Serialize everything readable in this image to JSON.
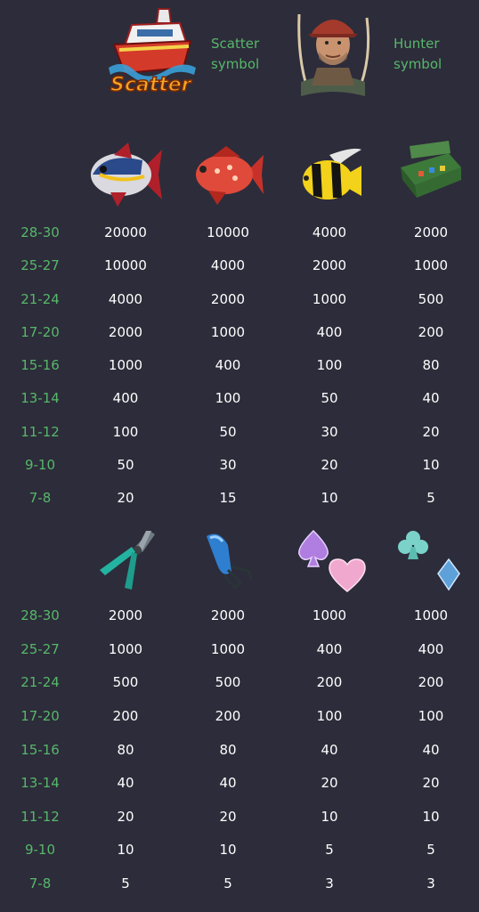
{
  "special_symbols": [
    {
      "name": "Scatter symbol",
      "label_line1": "Scatter",
      "label_line2": "symbol",
      "logo_text": "Scatter",
      "icon": "boat-scatter-icon"
    },
    {
      "name": "Hunter symbol",
      "label_line1": "Hunter",
      "label_line2": "symbol",
      "icon": "fisherman-hunter-icon"
    }
  ],
  "tables": [
    {
      "symbols": [
        "tuna-fish-icon",
        "red-fish-icon",
        "angelfish-icon",
        "tackle-box-icon"
      ],
      "rows": [
        {
          "range": "28-30",
          "values": [
            "20000",
            "10000",
            "4000",
            "2000"
          ]
        },
        {
          "range": "25-27",
          "values": [
            "10000",
            "4000",
            "2000",
            "1000"
          ]
        },
        {
          "range": "21-24",
          "values": [
            "4000",
            "2000",
            "1000",
            "500"
          ]
        },
        {
          "range": "17-20",
          "values": [
            "2000",
            "1000",
            "400",
            "200"
          ]
        },
        {
          "range": "15-16",
          "values": [
            "1000",
            "400",
            "100",
            "80"
          ]
        },
        {
          "range": "13-14",
          "values": [
            "400",
            "100",
            "50",
            "40"
          ]
        },
        {
          "range": "11-12",
          "values": [
            "100",
            "50",
            "30",
            "20"
          ]
        },
        {
          "range": "9-10",
          "values": [
            "50",
            "30",
            "20",
            "10"
          ]
        },
        {
          "range": "7-8",
          "values": [
            "20",
            "15",
            "10",
            "5"
          ]
        }
      ]
    },
    {
      "symbols": [
        "pliers-icon",
        "fishing-lure-icon",
        "spade-heart-icon",
        "club-diamond-icon"
      ],
      "rows": [
        {
          "range": "28-30",
          "values": [
            "2000",
            "2000",
            "1000",
            "1000"
          ]
        },
        {
          "range": "25-27",
          "values": [
            "1000",
            "1000",
            "400",
            "400"
          ]
        },
        {
          "range": "21-24",
          "values": [
            "500",
            "500",
            "200",
            "200"
          ]
        },
        {
          "range": "17-20",
          "values": [
            "200",
            "200",
            "100",
            "100"
          ]
        },
        {
          "range": "15-16",
          "values": [
            "80",
            "80",
            "40",
            "40"
          ]
        },
        {
          "range": "13-14",
          "values": [
            "40",
            "40",
            "20",
            "20"
          ]
        },
        {
          "range": "11-12",
          "values": [
            "20",
            "20",
            "10",
            "10"
          ]
        },
        {
          "range": "9-10",
          "values": [
            "10",
            "10",
            "5",
            "5"
          ]
        },
        {
          "range": "7-8",
          "values": [
            "5",
            "5",
            "3",
            "3"
          ]
        }
      ]
    }
  ],
  "colors": {
    "background": "#2d2c3a",
    "range_label": "#56b86a",
    "value_text": "#ffffff"
  }
}
